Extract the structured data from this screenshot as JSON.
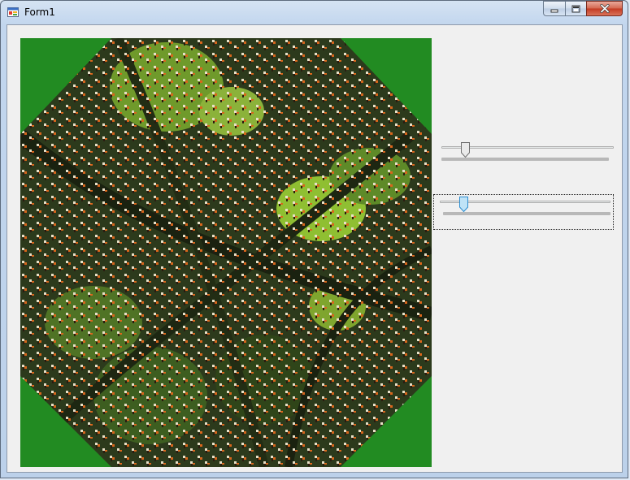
{
  "window": {
    "title": "Form1"
  },
  "icons": {
    "app": "form-app-icon",
    "minimize": "minimize-icon",
    "maximize": "maximize-icon",
    "close": "close-icon"
  },
  "colors": {
    "picture_background": "#228b22",
    "client_background": "#f0f0f0"
  },
  "trackbars": [
    {
      "name": "trackbar-1",
      "value_fraction": 0.14,
      "focused": false
    },
    {
      "name": "trackbar-2",
      "value_fraction": 0.12,
      "focused": true
    }
  ]
}
